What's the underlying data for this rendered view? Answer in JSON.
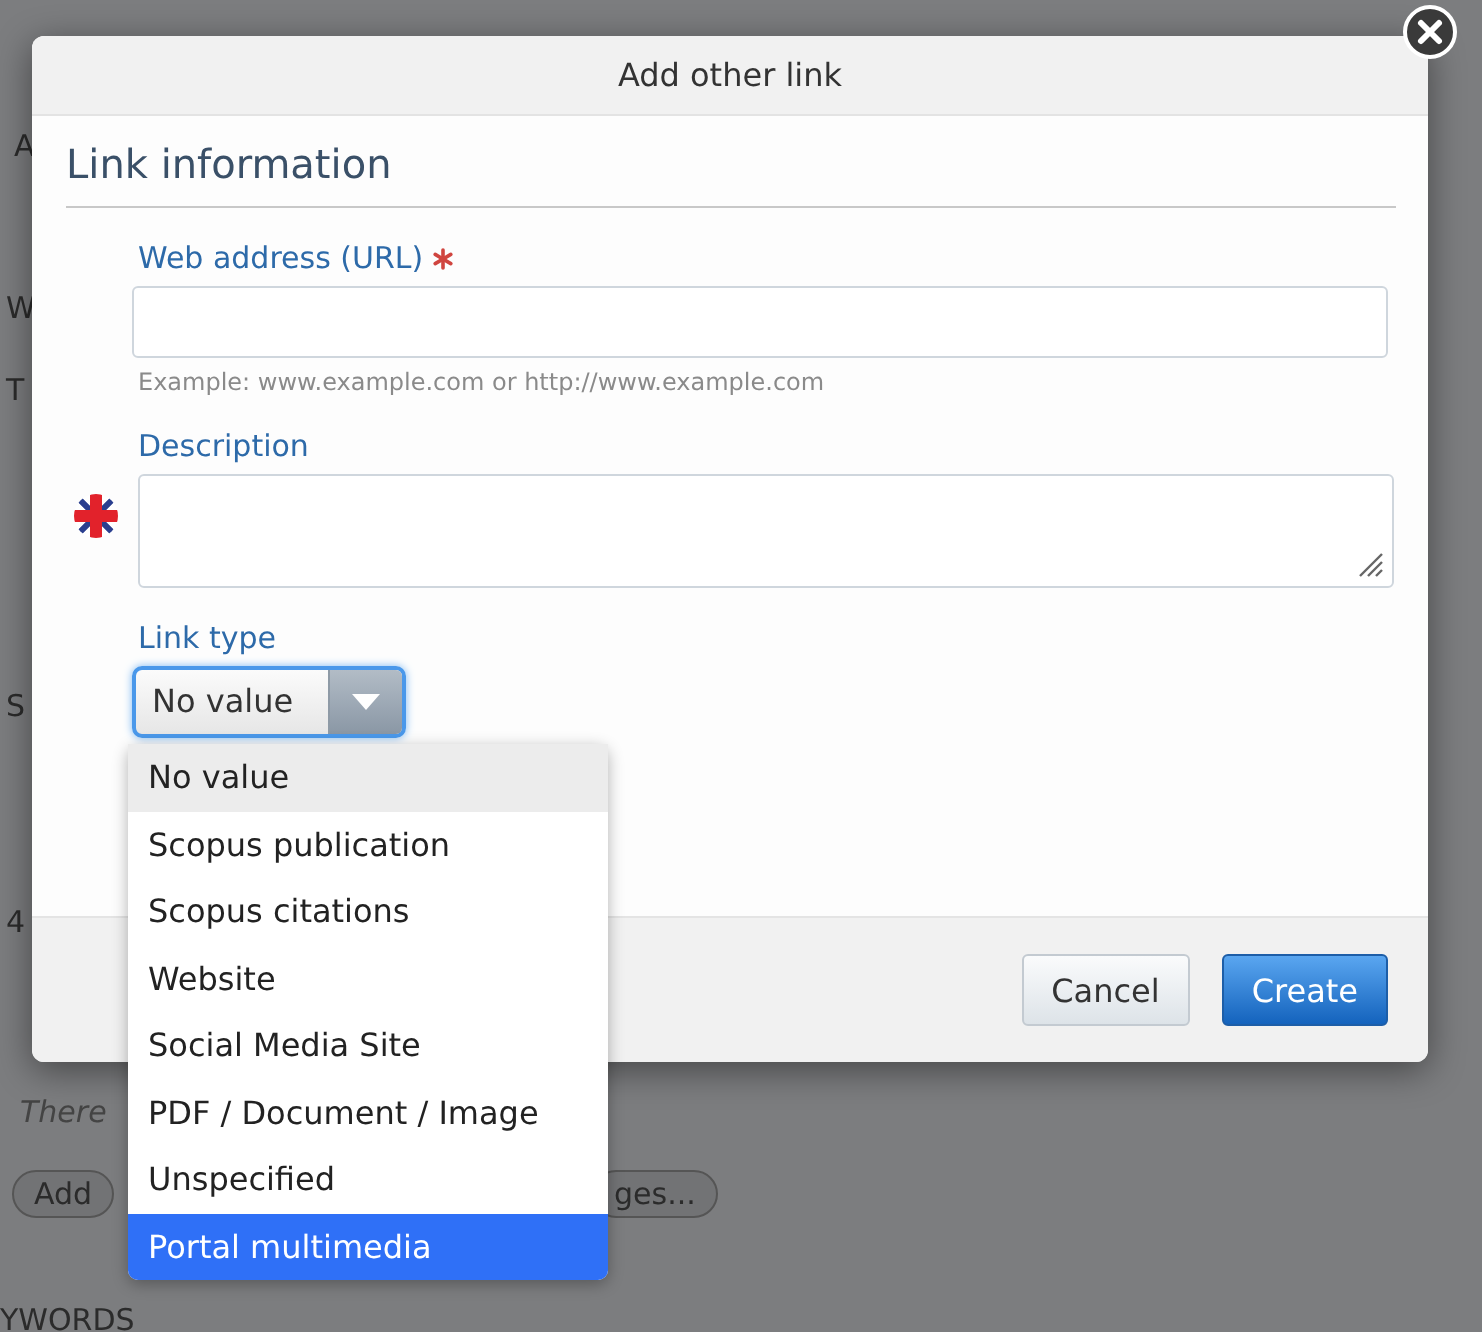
{
  "background_page": {
    "fragments": [
      {
        "text": "A",
        "kind": "plain"
      },
      {
        "text": "W",
        "kind": "plain"
      },
      {
        "text": "T",
        "kind": "plain"
      },
      {
        "text": "S",
        "kind": "plain"
      },
      {
        "text": "4",
        "kind": "plain"
      },
      {
        "text": "There",
        "kind": "note"
      },
      {
        "text": "Add",
        "kind": "button"
      },
      {
        "text": "ges...",
        "kind": "button"
      },
      {
        "text": "YWORDS",
        "kind": "heading"
      }
    ]
  },
  "dialog": {
    "title": "Add other link",
    "section": "Link information",
    "fields": [
      {
        "kind": "text",
        "label": "Web address (URL)",
        "required": true,
        "hint": "Example: www.example.com or http://www.example.com",
        "flag": false
      },
      {
        "kind": "textarea",
        "label": "Description",
        "required": false,
        "flag": true
      },
      {
        "kind": "select",
        "label": "Link type",
        "value": "No value",
        "open": true
      }
    ],
    "options": [
      {
        "label": "No value",
        "current": true,
        "selected": false
      },
      {
        "label": "Scopus publication",
        "current": false,
        "selected": false
      },
      {
        "label": "Scopus citations",
        "current": false,
        "selected": false
      },
      {
        "label": "Website",
        "current": false,
        "selected": false
      },
      {
        "label": "Social Media Site",
        "current": false,
        "selected": false
      },
      {
        "label": "PDF / Document / Image",
        "current": false,
        "selected": false
      },
      {
        "label": "Unspecified",
        "current": false,
        "selected": false
      },
      {
        "label": "Portal multimedia",
        "current": false,
        "selected": true
      }
    ],
    "buttons": [
      {
        "label": "Cancel",
        "kind": "secondary"
      },
      {
        "label": "Create",
        "kind": "primary"
      }
    ]
  }
}
